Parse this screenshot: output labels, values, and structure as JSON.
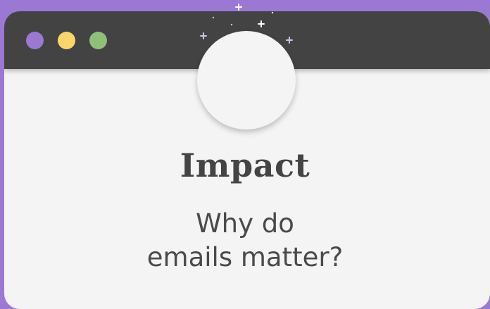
{
  "window": {
    "controls": [
      {
        "name": "close",
        "color": "#9b78d4"
      },
      {
        "name": "minimize",
        "color": "#fcd56a"
      },
      {
        "name": "maximize",
        "color": "#8fc07a"
      }
    ],
    "titlebar_color": "#434343",
    "background_color": "#9b78d4"
  },
  "hero": {
    "title": "Impact",
    "subtitle_line1": "Why do",
    "subtitle_line2": "emails matter?"
  },
  "decor": {
    "icon": "sparkle-icon"
  }
}
